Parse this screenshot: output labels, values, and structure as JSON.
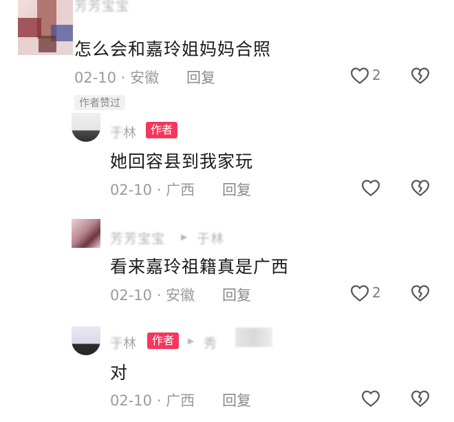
{
  "comments": [
    {
      "author": "芳芳宝宝",
      "text": "怎么会和嘉玲姐妈妈合照",
      "date": "02-10",
      "location": "安徽",
      "reply_label": "回复",
      "like_count": "2",
      "liked_by_author_label": "作者赞过"
    }
  ],
  "replies": [
    {
      "author": "于林",
      "author_tag": "作者",
      "text": "她回容县到我家玩",
      "date": "02-10",
      "location": "广西",
      "reply_label": "回复"
    },
    {
      "author": "芳芳宝宝",
      "reply_to": "于林",
      "text": "看来嘉玲祖籍真是广西",
      "date": "02-10",
      "location": "安徽",
      "reply_label": "回复",
      "like_count": "2"
    },
    {
      "author": "林",
      "author_tag": "作者",
      "reply_to": "秀",
      "text": "对",
      "date": "02-10",
      "location": "广西",
      "reply_label": "回复"
    }
  ],
  "separator": "·",
  "icons": {
    "like": "heart-outline-icon",
    "dislike": "broken-heart-icon",
    "reply_arrow": "reply-arrow-icon"
  }
}
